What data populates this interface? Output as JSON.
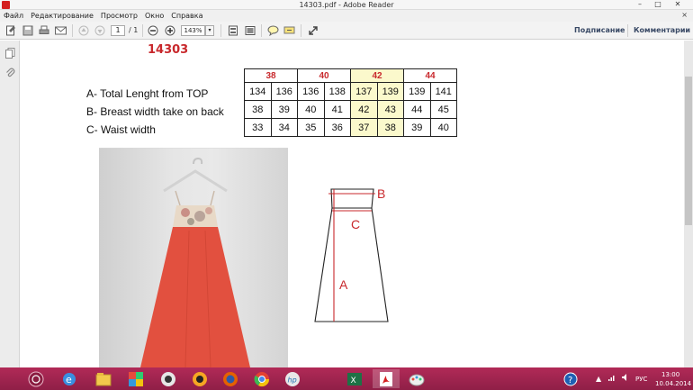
{
  "window": {
    "title": "14303.pdf - Adobe Reader",
    "minimize": "–",
    "maximize": "□",
    "close": "✕"
  },
  "menu": {
    "items": [
      "Файл",
      "Редактирование",
      "Просмотр",
      "Окно",
      "Справка"
    ],
    "close": "×"
  },
  "toolbar": {
    "page_current": "1",
    "page_total": "/ 1",
    "zoom": "143%",
    "zoom_dropdown": "▾",
    "sign_label": "Подписание",
    "comments_label": "Комментарии"
  },
  "document": {
    "model_number": "14303",
    "measurements": [
      "A- Total Lenght from TOP",
      "B- Breast width take on back",
      "C- Waist width"
    ],
    "sizes": [
      "38",
      "40",
      "42",
      "44"
    ],
    "table_rows": [
      [
        "134",
        "136",
        "136",
        "138",
        "137",
        "139",
        "139",
        "141"
      ],
      [
        "38",
        "39",
        "40",
        "41",
        "42",
        "43",
        "44",
        "45"
      ],
      [
        "33",
        "34",
        "35",
        "36",
        "37",
        "38",
        "39",
        "40"
      ]
    ],
    "highlighted_size": "42",
    "diagram_labels": {
      "a": "A",
      "b": "B",
      "c": "C"
    }
  },
  "tray": {
    "language": "РУС",
    "time": "13:00",
    "date": "10.04.2014",
    "help": "?"
  },
  "colors": {
    "accent_red": "#c8282c",
    "highlight": "#fbf9cc",
    "taskbar": "#a3264f",
    "dress": "#e2503f"
  },
  "icons": {
    "taskbar": [
      "start-icon",
      "ie-icon",
      "explorer-icon",
      "media-icon",
      "aimp-icon",
      "firefox-icon",
      "chrome-icon",
      "hp-icon",
      "excel-icon",
      "acrobat-icon",
      "paint-icon"
    ]
  }
}
